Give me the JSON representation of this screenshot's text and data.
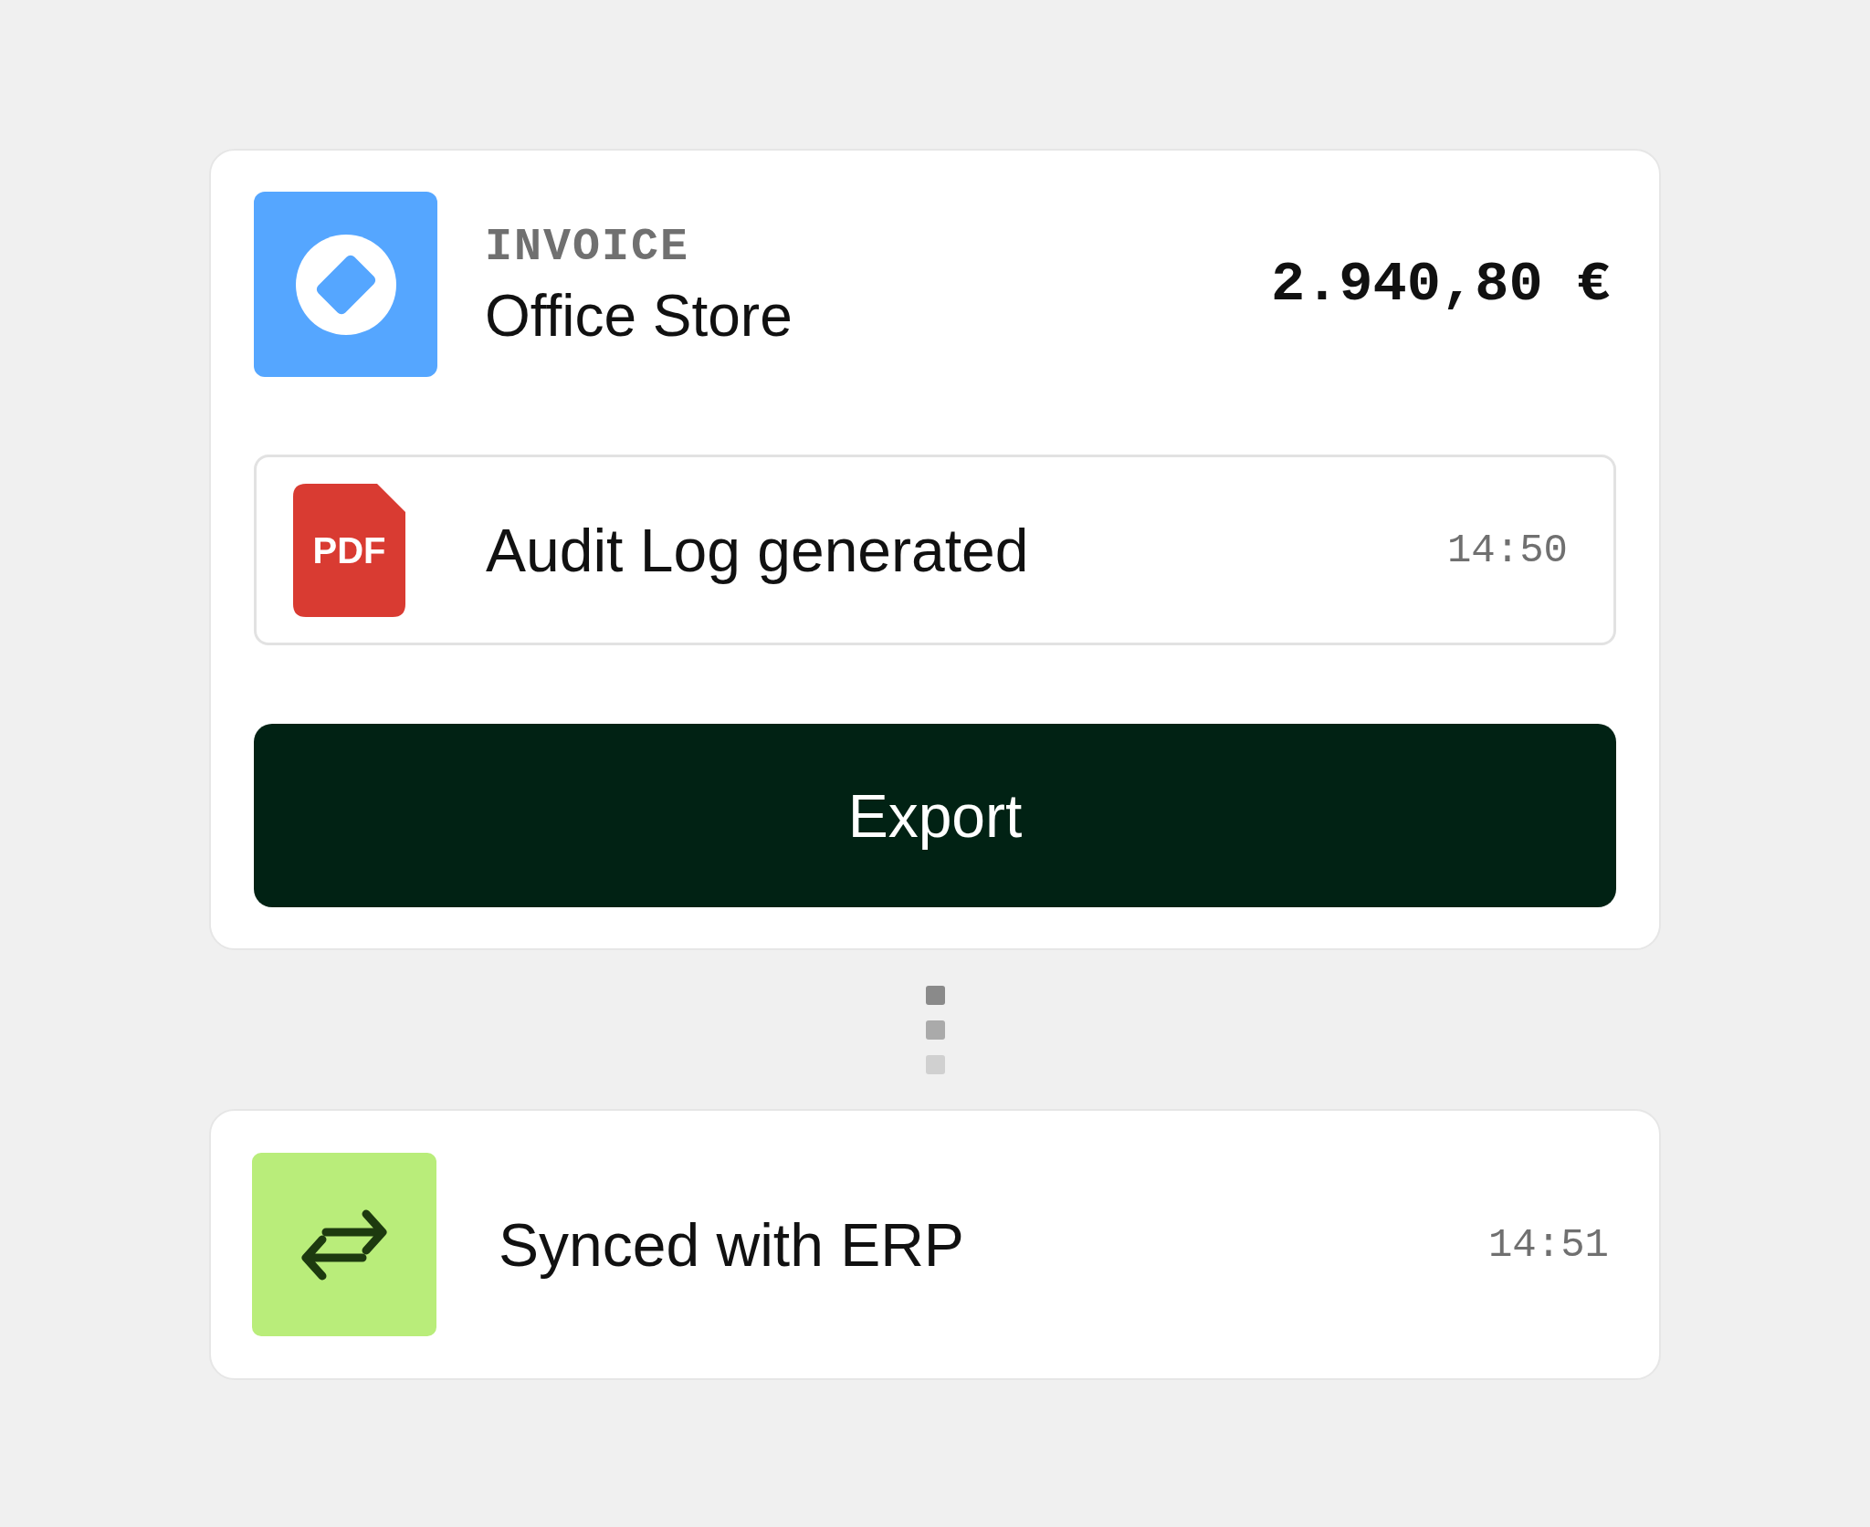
{
  "invoice": {
    "label": "INVOICE",
    "vendor": "Office Store",
    "amount": "2.940,80 €"
  },
  "audit": {
    "badge": "PDF",
    "text": "Audit Log generated",
    "time": "14:50"
  },
  "export_button": "Export",
  "sync": {
    "text": "Synced with ERP",
    "time": "14:51"
  }
}
